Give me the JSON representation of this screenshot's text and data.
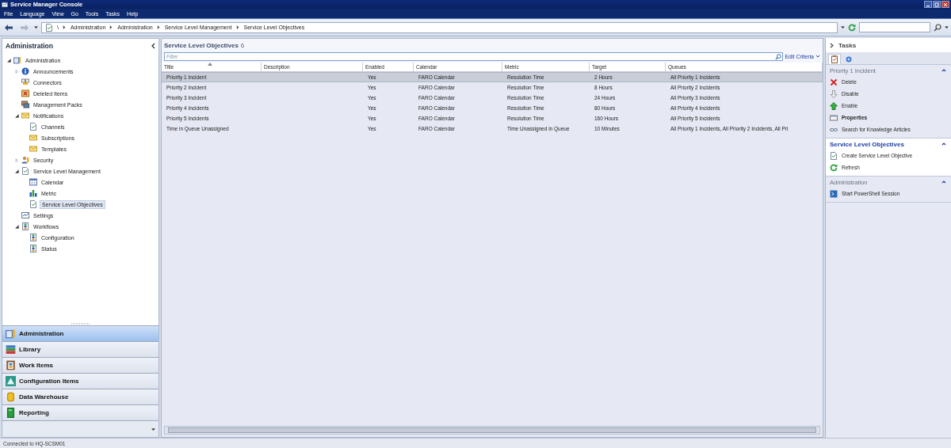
{
  "window": {
    "title": "Service Manager Console"
  },
  "menu": [
    "File",
    "Language",
    "View",
    "Go",
    "Tools",
    "Tasks",
    "Help"
  ],
  "address": {
    "root": "\\",
    "crumbs": [
      "Administration",
      "Administration",
      "Service Level Management",
      "Service Level Objectives"
    ]
  },
  "navigation": {
    "title": "Administration",
    "tree": [
      {
        "label": "Administration",
        "expanded": true,
        "selected": false,
        "children": [
          {
            "label": "Announcements",
            "expanded": false,
            "selected": false
          },
          {
            "label": "Connectors",
            "selected": false
          },
          {
            "label": "Deleted Items",
            "selected": false
          },
          {
            "label": "Management Packs",
            "selected": false
          },
          {
            "label": "Notifications",
            "expanded": true,
            "selected": false,
            "children": [
              {
                "label": "Channels",
                "selected": false
              },
              {
                "label": "Subscriptions",
                "selected": false
              },
              {
                "label": "Templates",
                "selected": false
              }
            ]
          },
          {
            "label": "Security",
            "expanded": false,
            "selected": false
          },
          {
            "label": "Service Level Management",
            "expanded": true,
            "selected": false,
            "children": [
              {
                "label": "Calendar",
                "selected": false
              },
              {
                "label": "Metric",
                "selected": false
              },
              {
                "label": "Service Level Objectives",
                "selected": true
              }
            ]
          },
          {
            "label": "Settings",
            "selected": false
          },
          {
            "label": "Workflows",
            "expanded": true,
            "selected": false,
            "children": [
              {
                "label": "Configuration",
                "selected": false
              },
              {
                "label": "Status",
                "selected": false
              }
            ]
          }
        ]
      }
    ],
    "workspaces": [
      {
        "label": "Administration",
        "selected": true
      },
      {
        "label": "Library",
        "selected": false
      },
      {
        "label": "Work Items",
        "selected": false
      },
      {
        "label": "Configuration Items",
        "selected": false
      },
      {
        "label": "Data Warehouse",
        "selected": false
      },
      {
        "label": "Reporting",
        "selected": false
      }
    ]
  },
  "view": {
    "title": "Service Level Objectives",
    "count": "6",
    "filter_placeholder": "Filter",
    "edit_criteria": "Edit Criteria",
    "columns": [
      {
        "label": "Title",
        "sorted": true
      },
      {
        "label": "Description",
        "sorted": false
      },
      {
        "label": "Enabled",
        "sorted": false
      },
      {
        "label": "Calendar",
        "sorted": false
      },
      {
        "label": "Metric",
        "sorted": false
      },
      {
        "label": "Target",
        "sorted": false
      },
      {
        "label": "Queues",
        "sorted": false
      }
    ],
    "rows": [
      {
        "selected": true,
        "cells": [
          "Priority 1 Incident",
          null,
          "Yes",
          "FARO Calendar",
          "Resolution Time",
          "2 Hours",
          "All Priority 1 Incidents"
        ]
      },
      {
        "selected": false,
        "cells": [
          "Priority 2 Incident",
          null,
          "Yes",
          "FARO Calendar",
          "Resolution Time",
          "8 Hours",
          "All Priority 2 Incidents"
        ]
      },
      {
        "selected": false,
        "cells": [
          "Priority 3 Incident",
          null,
          "Yes",
          "FARO Calendar",
          "Resolution Time",
          "24 Hours",
          "All Priority 3 Incidents"
        ]
      },
      {
        "selected": false,
        "cells": [
          "Priority 4 Incidents",
          null,
          "Yes",
          "FARO Calendar",
          "Resolution Time",
          "80 Hours",
          "All Priority 4 Incidents"
        ]
      },
      {
        "selected": false,
        "cells": [
          "Priority 5 Incidents",
          null,
          "Yes",
          "FARO Calendar",
          "Resolution Time",
          "160 Hours",
          "All Priority 5 Incidents"
        ]
      },
      {
        "selected": false,
        "cells": [
          "Time in Queue Unassigned",
          null,
          "Yes",
          "FARO Calendar",
          "Time Unassigned in Queue",
          "10 Minutes",
          "All Priority 1 Incidents, All Priority 2 Incidents, All Pri"
        ]
      }
    ]
  },
  "tasks": {
    "title": "Tasks",
    "sections": [
      {
        "title": "Priority 1 Incident",
        "active": false,
        "items": [
          {
            "label": "Delete",
            "bold": false
          },
          {
            "label": "Disable",
            "bold": false
          },
          {
            "label": "Enable",
            "bold": false
          },
          {
            "label": "Properties",
            "bold": true
          },
          {
            "label": "Search for Knowledge Articles",
            "bold": false
          }
        ]
      },
      {
        "title": "Service Level Objectives",
        "active": true,
        "items": [
          {
            "label": "Create Service Level Objective",
            "bold": false
          },
          {
            "label": "Refresh",
            "bold": false
          }
        ]
      },
      {
        "title": "Administration",
        "active": false,
        "items": [
          {
            "label": "Start PowerShell Session",
            "bold": false
          }
        ]
      }
    ]
  },
  "status_bar": "Connected to HQ-SCSM01"
}
